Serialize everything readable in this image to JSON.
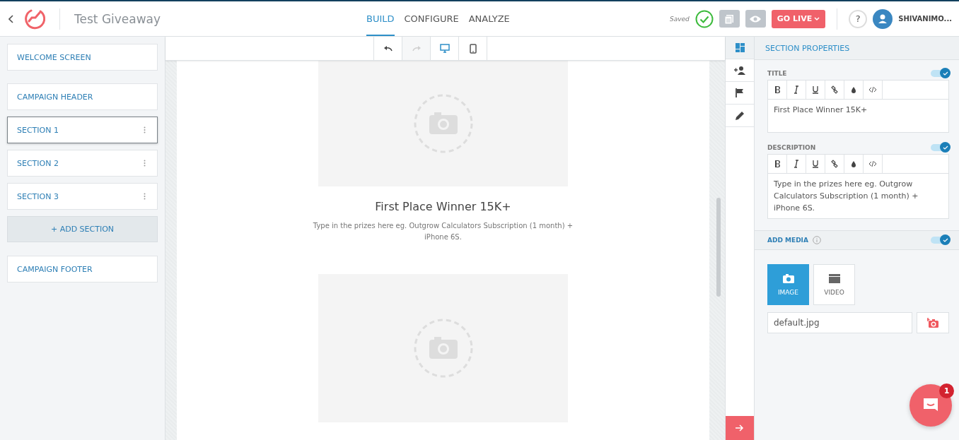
{
  "header": {
    "title": "Test Giveaway",
    "nav": [
      {
        "label": "BUILD",
        "selected": true
      },
      {
        "label": "CONFIGURE",
        "selected": false
      },
      {
        "label": "ANALYZE",
        "selected": false
      }
    ],
    "status": "Saved",
    "go_live": "GO LIVE",
    "help": "?",
    "user": "SHIVANIMO..."
  },
  "sidebar": {
    "items": [
      {
        "kind": "fixed",
        "label": "WELCOME SCREEN",
        "selected": false
      },
      {
        "kind": "fixed",
        "label": "CAMPAIGN HEADER",
        "selected": false
      },
      {
        "kind": "section",
        "label": "SECTION 1",
        "selected": true
      },
      {
        "kind": "section",
        "label": "SECTION 2",
        "selected": false
      },
      {
        "kind": "section",
        "label": "SECTION 3",
        "selected": false
      },
      {
        "kind": "add",
        "label": "+ ADD SECTION"
      },
      {
        "kind": "fixed",
        "label": "CAMPAIGN FOOTER",
        "selected": false
      }
    ]
  },
  "toolbar": {
    "history": [
      {
        "kind": "undo",
        "disabled": false
      },
      {
        "kind": "redo",
        "disabled": true
      }
    ],
    "views": [
      {
        "kind": "desktop",
        "selected": true
      },
      {
        "kind": "mobile",
        "selected": false
      }
    ]
  },
  "canvas": {
    "prizes": [
      {
        "kind": "image",
        "title": "First Place Winner 15K+",
        "description": "Type in the prizes here eg. Outgrow Calculators Subscription (1 month) + iPhone 6S."
      },
      {
        "kind": "image"
      }
    ]
  },
  "rail": [
    {
      "kind": "layout",
      "selected": true
    },
    {
      "kind": "person-add",
      "selected": false
    },
    {
      "kind": "flag",
      "selected": false
    },
    {
      "kind": "pencil",
      "selected": false
    }
  ],
  "panel": {
    "heading": "SECTION PROPERTIES",
    "fields": [
      {
        "label": "TITLE",
        "on": true,
        "text": "First Place Winner 15K+"
      },
      {
        "label": "DESCRIPTION",
        "on": true,
        "text": "Type in the prizes here eg. Outgrow Calculators Subscription (1 month) + iPhone 6S."
      }
    ],
    "media": {
      "label": "ADD MEDIA",
      "on": true,
      "tabs": [
        {
          "label": "IMAGE",
          "selected": true
        },
        {
          "label": "VIDEO",
          "selected": false
        }
      ],
      "file": "default.jpg"
    }
  },
  "chat": {
    "badge": "1"
  }
}
